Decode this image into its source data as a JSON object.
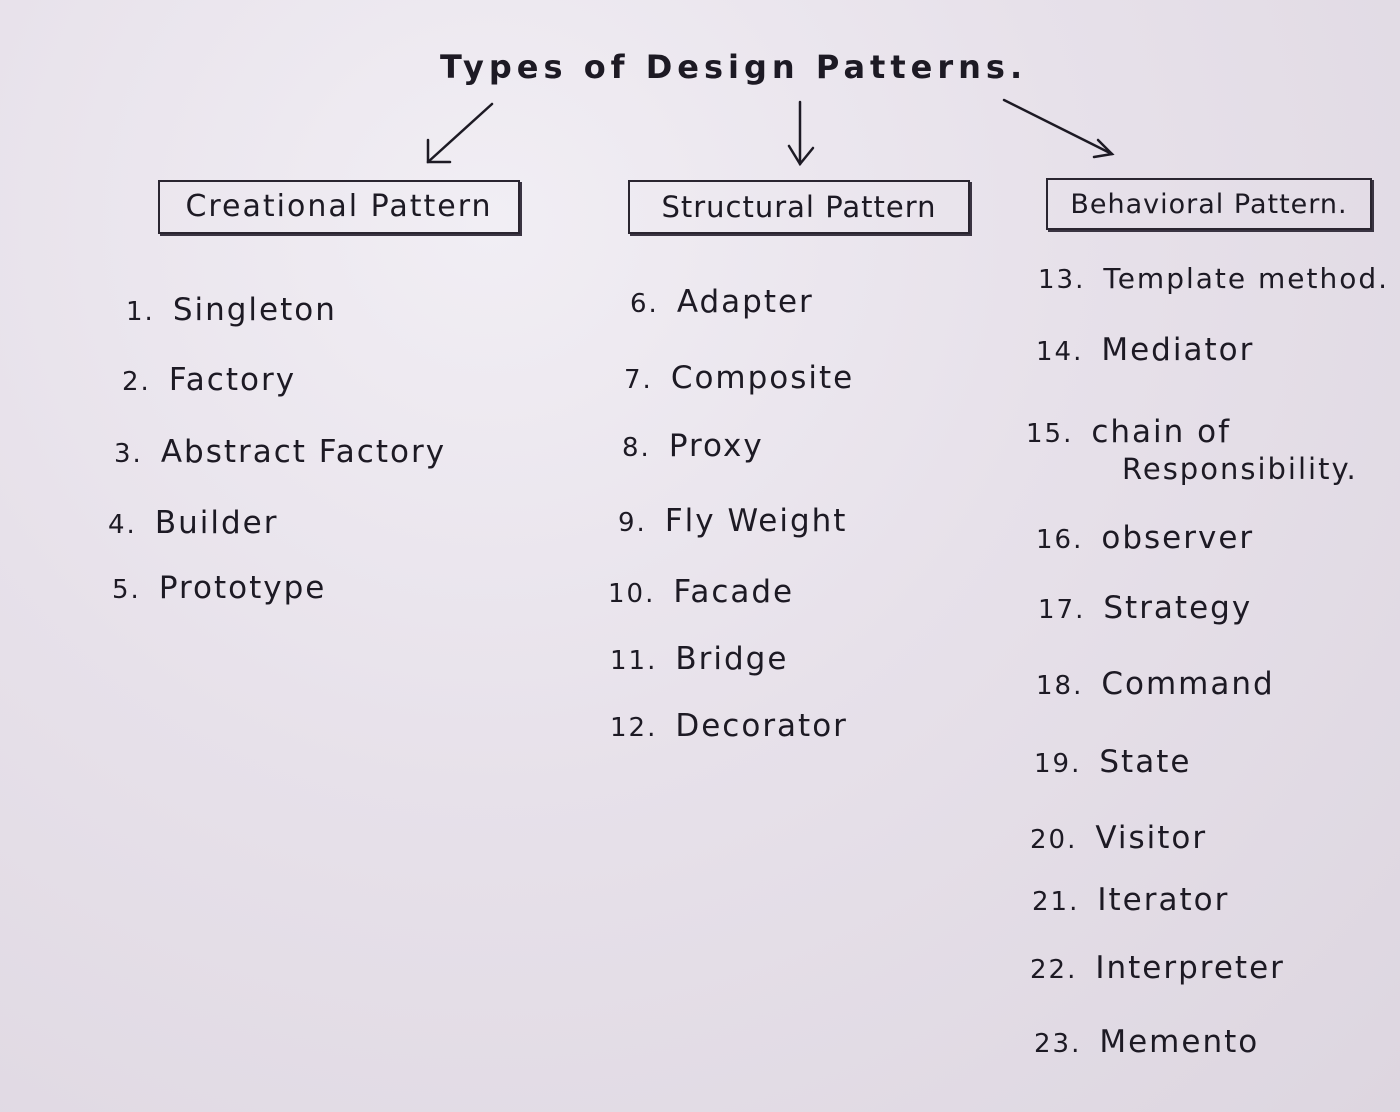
{
  "title": "Types of Design Patterns.",
  "categories": {
    "creational": {
      "label": "Creational Pattern",
      "items": [
        {
          "num": "1.",
          "name": "Singleton"
        },
        {
          "num": "2.",
          "name": "Factory"
        },
        {
          "num": "3.",
          "name": "Abstract Factory"
        },
        {
          "num": "4.",
          "name": "Builder"
        },
        {
          "num": "5.",
          "name": "Prototype"
        }
      ]
    },
    "structural": {
      "label": "Structural Pattern",
      "items": [
        {
          "num": "6.",
          "name": "Adapter"
        },
        {
          "num": "7.",
          "name": "Composite"
        },
        {
          "num": "8.",
          "name": "Proxy"
        },
        {
          "num": "9.",
          "name": "Fly Weight"
        },
        {
          "num": "10.",
          "name": "Facade"
        },
        {
          "num": "11.",
          "name": "Bridge"
        },
        {
          "num": "12.",
          "name": "Decorator"
        }
      ]
    },
    "behavioral": {
      "label": "Behavioral Pattern.",
      "items": [
        {
          "num": "13.",
          "name": "Template method."
        },
        {
          "num": "14.",
          "name": "Mediator"
        },
        {
          "num": "15.",
          "name": "chain of",
          "name2": "Responsibility."
        },
        {
          "num": "16.",
          "name": "observer"
        },
        {
          "num": "17.",
          "name": "Strategy"
        },
        {
          "num": "18.",
          "name": "Command"
        },
        {
          "num": "19.",
          "name": "State"
        },
        {
          "num": "20.",
          "name": "Visitor"
        },
        {
          "num": "21.",
          "name": "Iterator"
        },
        {
          "num": "22.",
          "name": "Interpreter"
        },
        {
          "num": "23.",
          "name": "Memento"
        }
      ]
    }
  }
}
